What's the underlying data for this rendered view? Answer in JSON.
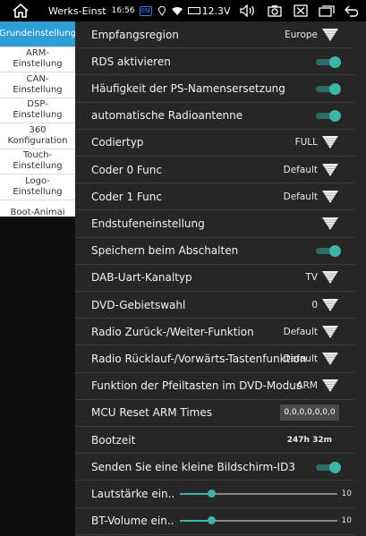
{
  "status": {
    "title": "Werks-Einst",
    "time": "16:56",
    "badge": "EN",
    "voltage": "12.3V"
  },
  "sidebar": {
    "items": [
      {
        "label": "Grundeinstellung",
        "active": true
      },
      {
        "label": "ARM-Einstellung",
        "active": false
      },
      {
        "label": "CAN-Einstellung",
        "active": false
      },
      {
        "label": "DSP-Einstellung",
        "active": false
      },
      {
        "label": "360 Konfiguration",
        "active": false
      },
      {
        "label": "Touch-Einstellung",
        "active": false
      },
      {
        "label": "Logo-Einstellung",
        "active": false
      },
      {
        "label": "Boot-Animai",
        "active": false
      }
    ]
  },
  "settings": [
    {
      "label": "Empfangsregion",
      "type": "select",
      "value": "Europe"
    },
    {
      "label": "RDS aktivieren",
      "type": "toggle",
      "on": true
    },
    {
      "label": "Häufigkeit der PS-Namensersetzung",
      "type": "toggle",
      "on": true
    },
    {
      "label": "automatische Radioantenne",
      "type": "toggle",
      "on": true
    },
    {
      "label": "Codiertyp",
      "type": "select",
      "value": "FULL"
    },
    {
      "label": "Coder 0 Func",
      "type": "select",
      "value": "Default"
    },
    {
      "label": "Coder 1 Func",
      "type": "select",
      "value": "Default"
    },
    {
      "label": "Endstufeneinstellung",
      "type": "select",
      "value": ""
    },
    {
      "label": "Speichern beim Abschalten",
      "type": "toggle",
      "on": true
    },
    {
      "label": "DAB-Uart-Kanaltyp",
      "type": "select",
      "value": "TV"
    },
    {
      "label": "DVD-Gebietswahl",
      "type": "select",
      "value": "0"
    },
    {
      "label": "Radio Zurück-/Weiter-Funktion",
      "type": "select",
      "value": "Default"
    },
    {
      "label": "Radio Rücklauf-/Vorwärts-Tastenfunktion",
      "type": "select",
      "value": "Default"
    },
    {
      "label": "Funktion der Pfeiltasten im DVD-Modus",
      "type": "select",
      "value": "ARM"
    },
    {
      "label": "MCU Reset ARM Times",
      "type": "button",
      "value": "0,0,0,0,0,0,0"
    },
    {
      "label": "Bootzeit",
      "type": "text",
      "value": "247h 32m"
    },
    {
      "label": "Senden Sie eine kleine Bildschirm-ID3",
      "type": "toggle",
      "on": true
    },
    {
      "label": "Lautstärke ein..",
      "type": "slider",
      "value": "10",
      "level": 0.2
    },
    {
      "label": "BT-Volume ein..",
      "type": "slider",
      "value": "10",
      "level": 0.2
    }
  ],
  "colors": {
    "accent": "#2f9ed6",
    "toggle_on": "#3fb5a8"
  },
  "icons": {
    "home": "home-icon",
    "back": "back-icon"
  }
}
